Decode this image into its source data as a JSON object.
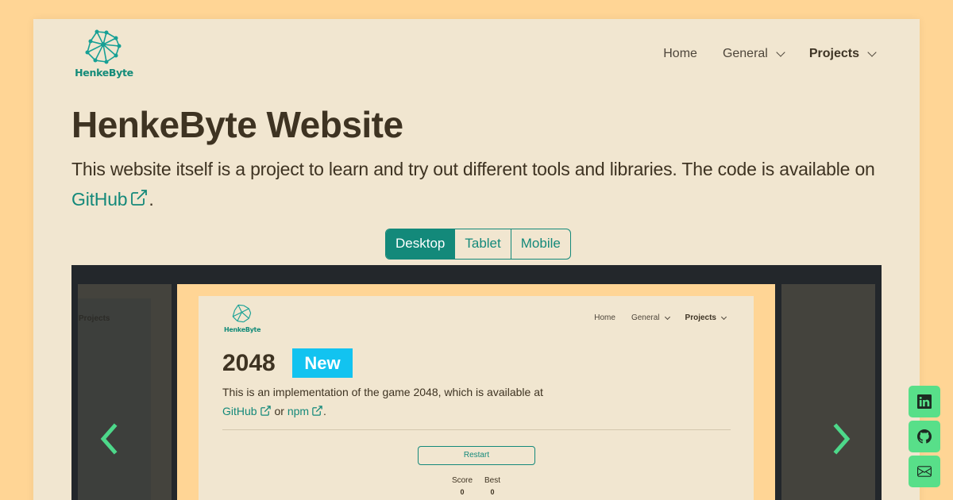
{
  "site": {
    "logo_text": "HenkeByte"
  },
  "nav": {
    "home": "Home",
    "general": "General",
    "projects": "Projects"
  },
  "page": {
    "title": "HenkeByte Website",
    "desc_prefix": "This website itself is a project to learn and try out different tools and libraries. The code is available on ",
    "github_link": "GitHub",
    "desc_suffix": "."
  },
  "view_toggle": {
    "options": [
      "Desktop",
      "Tablet",
      "Mobile"
    ],
    "selected": "Desktop"
  },
  "carousel": {
    "left_preview_nav": "Projects",
    "slide": {
      "logo_text": "HenkeByte",
      "nav": {
        "home": "Home",
        "general": "General",
        "projects": "Projects"
      },
      "title": "2048",
      "badge": "New",
      "desc_line1": "This is an implementation of the game 2048, which is available at",
      "link_github": "GitHub",
      "or_text": " or ",
      "link_npm": "npm",
      "period": ".",
      "restart_label": "Restart",
      "score_label": "Score",
      "score_value": "0",
      "best_label": "Best",
      "best_value": "0"
    }
  },
  "social": {
    "icons": [
      "linkedin-icon",
      "github-icon",
      "mail-icon"
    ]
  },
  "colors": {
    "page_bg": "#ffd595",
    "card_bg": "#f1e6d0",
    "accent": "#13897a",
    "badge": "#12c3f0",
    "social_btn": "#58df89",
    "arrow": "#4dd88a"
  }
}
